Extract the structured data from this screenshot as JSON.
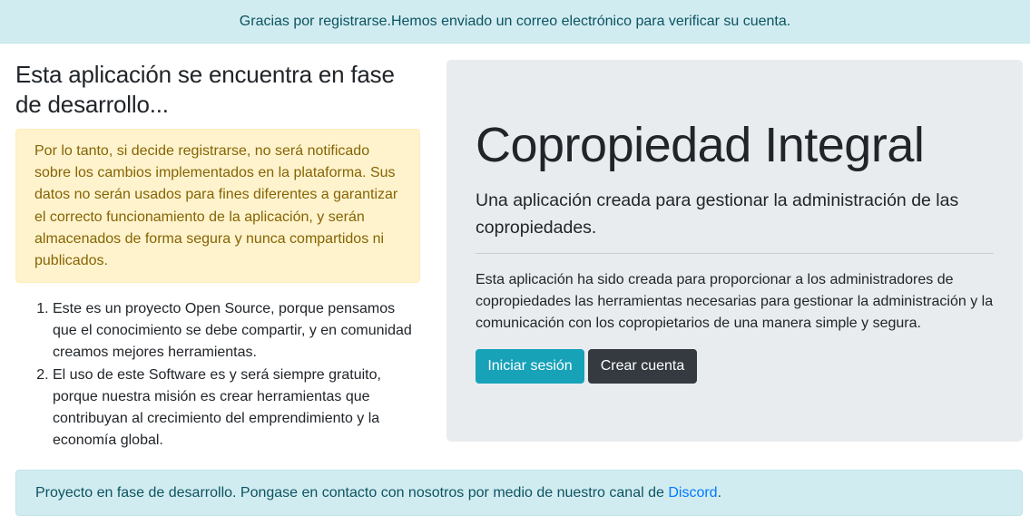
{
  "top_alert": {
    "text": "Gracias por registrarse.Hemos enviado un correo electrónico para verificar su cuenta."
  },
  "left": {
    "title": "Esta aplicación se encuentra en fase de desarrollo...",
    "warning": "Por lo tanto, si decide registrarse, no será notificado sobre los cambios implementados en la plataforma. Sus datos no serán usados para fines diferentes a garantizar el correcto funcionamiento de la aplicación, y serán almacenados de forma segura y nunca compartidos ni publicados.",
    "points": [
      "Este es un proyecto Open Source, porque pensamos que el conocimiento se debe compartir, y en comunidad creamos mejores herramientas.",
      "El uso de este Software es y será siempre gratuito, porque nuestra misión es crear herramientas que contribuyan al crecimiento del emprendimiento y la economía global."
    ]
  },
  "jumbotron": {
    "title": "Copropiedad Integral",
    "lead": "Una aplicación creada para gestionar la administración de las copropiedades.",
    "body": "Esta aplicación ha sido creada para proporcionar a los administradores de copropiedades las herramientas necesarias para gestionar la administración y la comunicación con los copropietarios de una manera simple y segura.",
    "login_label": "Iniciar sesión",
    "signup_label": "Crear cuenta"
  },
  "bottom_alert": {
    "text": "Proyecto en fase de desarrollo. Pongase en contacto con nosotros por medio de nuestro canal de",
    "link_label": "Discord",
    "suffix": "."
  }
}
